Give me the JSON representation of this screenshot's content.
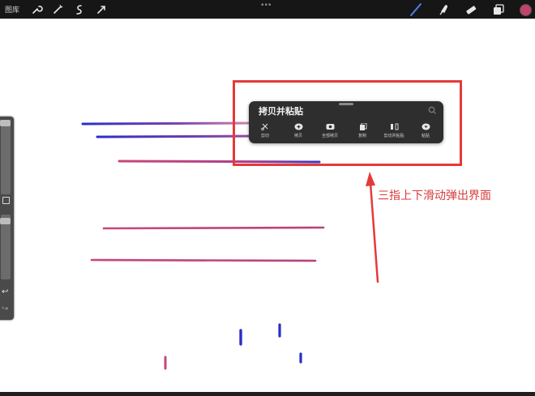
{
  "topbar": {
    "gallery_label": "图库",
    "tools_left": [
      "wrench-icon",
      "magic-wand-icon",
      "selection-icon",
      "transform-arrow-icon"
    ],
    "tools_right": [
      "brush-icon",
      "smudge-icon",
      "eraser-icon",
      "layers-icon"
    ],
    "more_glyph": "•••",
    "current_color": "#c2426a"
  },
  "sidebar": {
    "undo_glyph": "↩",
    "redo_glyph": "↪"
  },
  "copy_paste_panel": {
    "title": "拷贝并粘贴",
    "actions": [
      {
        "label": "剪切",
        "icon": "scissors-icon"
      },
      {
        "label": "拷贝",
        "icon": "copy-icon"
      },
      {
        "label": "全部拷贝",
        "icon": "copy-all-icon"
      },
      {
        "label": "复制",
        "icon": "duplicate-icon"
      },
      {
        "label": "剪切并粘贴",
        "icon": "cut-and-paste-icon"
      },
      {
        "label": "粘贴",
        "icon": "paste-icon"
      }
    ]
  },
  "annotation": {
    "text": "三指上下滑动弹出界面",
    "color": "#d93a3a"
  },
  "colors": {
    "stroke_blue": "#2b2ec7",
    "stroke_pink": "#c8467a",
    "stroke_light_pink": "#d98aa5",
    "highlight_red": "#e53a3a"
  }
}
